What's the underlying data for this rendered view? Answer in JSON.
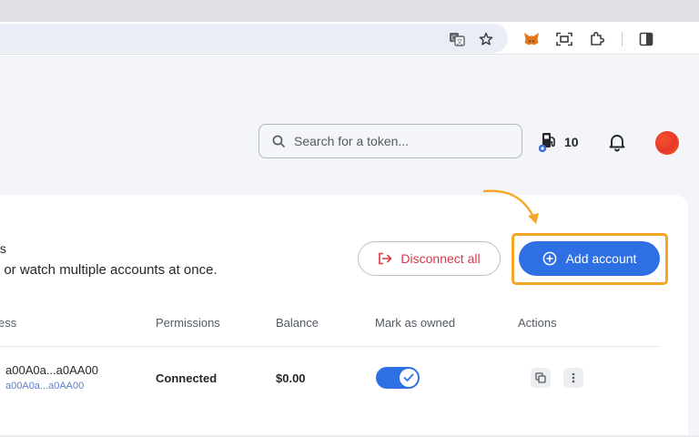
{
  "browser": {
    "icons": [
      "translate-icon",
      "star-icon",
      "metamask-fox-icon",
      "screenshot-icon",
      "extensions-icon",
      "side-panel-icon"
    ]
  },
  "header": {
    "search_placeholder": "Search for a token...",
    "gas_count": "10"
  },
  "card": {
    "title": "ts",
    "subtitle": "t or watch multiple accounts at once.",
    "disconnect_label": "Disconnect all",
    "add_account_label": "Add account"
  },
  "table": {
    "headers": {
      "address": "ess",
      "permissions": "Permissions",
      "balance": "Balance",
      "owned": "Mark as owned",
      "actions": "Actions"
    },
    "rows": [
      {
        "address": "a00A0a...a0AA00",
        "address_sub": "a00A0a...a0AA00",
        "permission": "Connected",
        "balance": "$0.00",
        "owned": true
      }
    ]
  },
  "colors": {
    "accent": "#2f6fe4",
    "danger": "#d73847",
    "highlight": "#f5a623"
  }
}
